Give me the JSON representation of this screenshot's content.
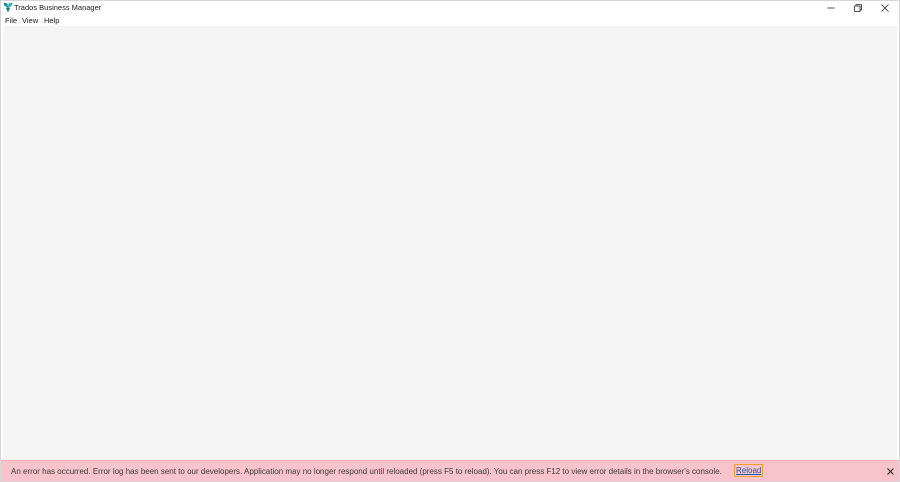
{
  "window": {
    "title": "Trados Business Manager",
    "controls": {
      "minimize": "minimize-icon",
      "restore": "restore-icon",
      "close": "close-icon"
    }
  },
  "menu": {
    "file": "File",
    "view": "View",
    "help": "Help"
  },
  "colors": {
    "content_bg": "#f5f5f5",
    "error_bg": "#f8c4cb",
    "link": "#1e5aa8",
    "logo": "#1a8fa0"
  },
  "error_banner": {
    "message": "An error has occurred. Error log has been sent to our developers. Application may no longer respond until reloaded (press F5 to reload). You can press F12 to view error details in the browser's console.",
    "reload_label": "Reload",
    "close_icon": "close-icon"
  }
}
